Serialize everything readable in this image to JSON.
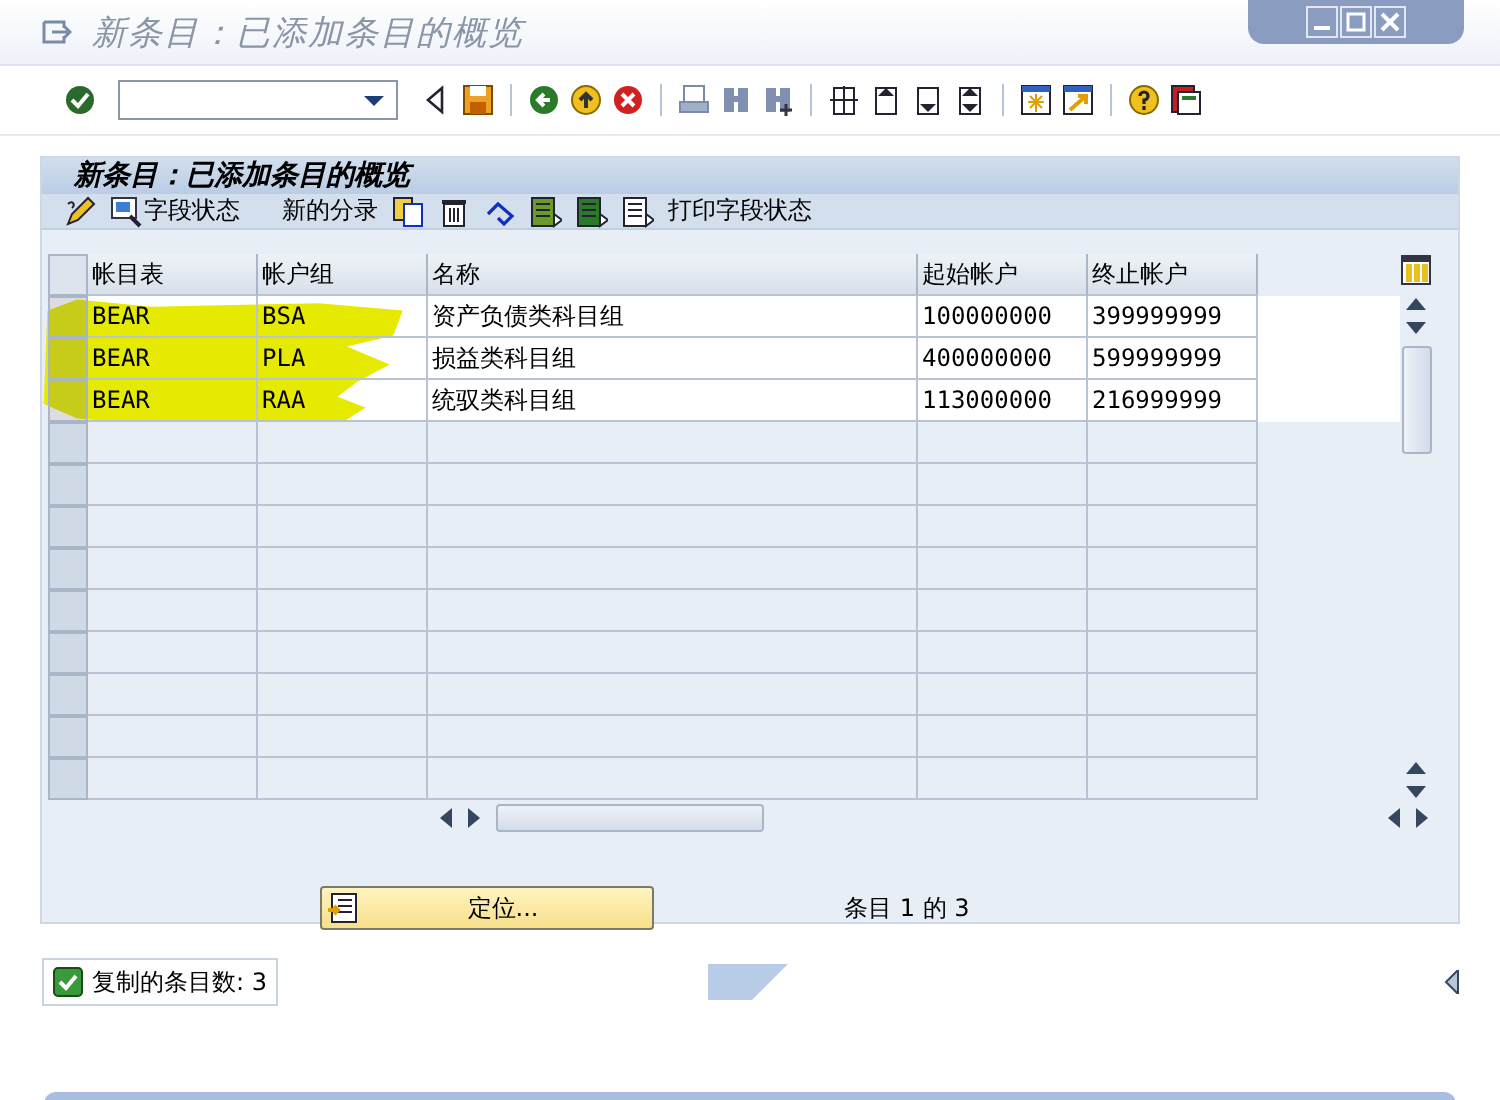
{
  "window": {
    "title": "新条目：已添加条目的概览"
  },
  "panel": {
    "title": "新条目：已添加条目的概览"
  },
  "app_toolbar": [
    {
      "kind": "icon-text",
      "label": "字段状态"
    },
    {
      "kind": "text",
      "label": "新的分录"
    },
    {
      "kind": "text",
      "label": "打印字段状态"
    }
  ],
  "table": {
    "columns": [
      "帐目表",
      "帐户组",
      "名称",
      "起始帐户",
      "终止帐户"
    ],
    "rows": [
      [
        "BEAR",
        "BSA",
        "资产负债类科目组",
        "100000000",
        "399999999"
      ],
      [
        "BEAR",
        "PLA",
        "损益类科目组",
        "400000000",
        "599999999"
      ],
      [
        "BEAR",
        "RAA",
        "统驭类科目组",
        "113000000",
        "216999999"
      ]
    ],
    "highlighted": true
  },
  "position_button": {
    "label": "定位..."
  },
  "entry_info": "条目 1 的 3",
  "status_bar": {
    "success": true,
    "message": "复制的条目数: 3"
  }
}
